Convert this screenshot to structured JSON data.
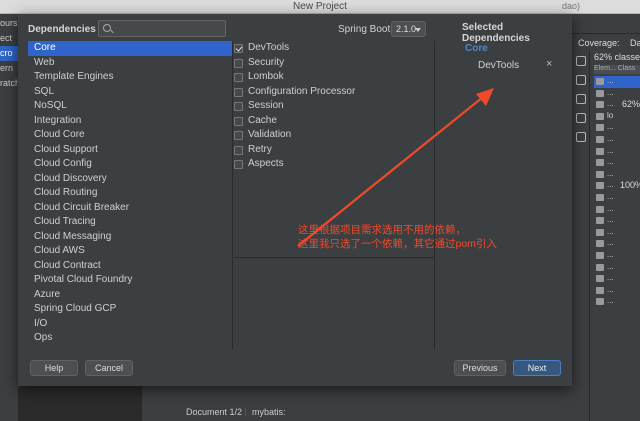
{
  "window": {
    "title": "New Project",
    "title_right": "dao)"
  },
  "ide_left": {
    "items": [
      "ours",
      "ect",
      "cro",
      "ern",
      "ratch"
    ]
  },
  "dialog": {
    "dependencies_label": "Dependencies",
    "search_placeholder": "",
    "spring_boot_label": "Spring Boot",
    "spring_boot_version": "2.1.0",
    "selected_title": "Selected Dependencies",
    "categories": [
      "Core",
      "Web",
      "Template Engines",
      "SQL",
      "NoSQL",
      "Integration",
      "Cloud Core",
      "Cloud Support",
      "Cloud Config",
      "Cloud Discovery",
      "Cloud Routing",
      "Cloud Circuit Breaker",
      "Cloud Tracing",
      "Cloud Messaging",
      "Cloud AWS",
      "Cloud Contract",
      "Pivotal Cloud Foundry",
      "Azure",
      "Spring Cloud GCP",
      "I/O",
      "Ops"
    ],
    "selected_category": "Core",
    "dependencies": [
      {
        "label": "DevTools",
        "checked": true
      },
      {
        "label": "Security",
        "checked": false
      },
      {
        "label": "Lombok",
        "checked": false
      },
      {
        "label": "Configuration Processor",
        "checked": false
      },
      {
        "label": "Session",
        "checked": false
      },
      {
        "label": "Cache",
        "checked": false
      },
      {
        "label": "Validation",
        "checked": false
      },
      {
        "label": "Retry",
        "checked": false
      },
      {
        "label": "Aspects",
        "checked": false
      }
    ],
    "selected": {
      "group": "Core",
      "items": [
        "DevTools"
      ],
      "remove_glyph": "×"
    },
    "buttons": {
      "help": "Help",
      "cancel": "Cancel",
      "previous": "Previous",
      "next": "Next"
    }
  },
  "coverage": {
    "tab": "Coverage:",
    "tab2": "Da",
    "summary": "62% classes",
    "header": "Elem... Class",
    "row_text": "...",
    "row_text_short": "lo",
    "side_values": [
      "62%",
      "100%"
    ]
  },
  "bottom": {
    "document": "Document 1/2",
    "context": "mybatis:"
  },
  "annotation": {
    "lines": [
      "这里根据项目需求选用不用的依赖，",
      "这里我只选了一个依赖，其它通过pom引入"
    ],
    "color": "#f04a2a"
  }
}
